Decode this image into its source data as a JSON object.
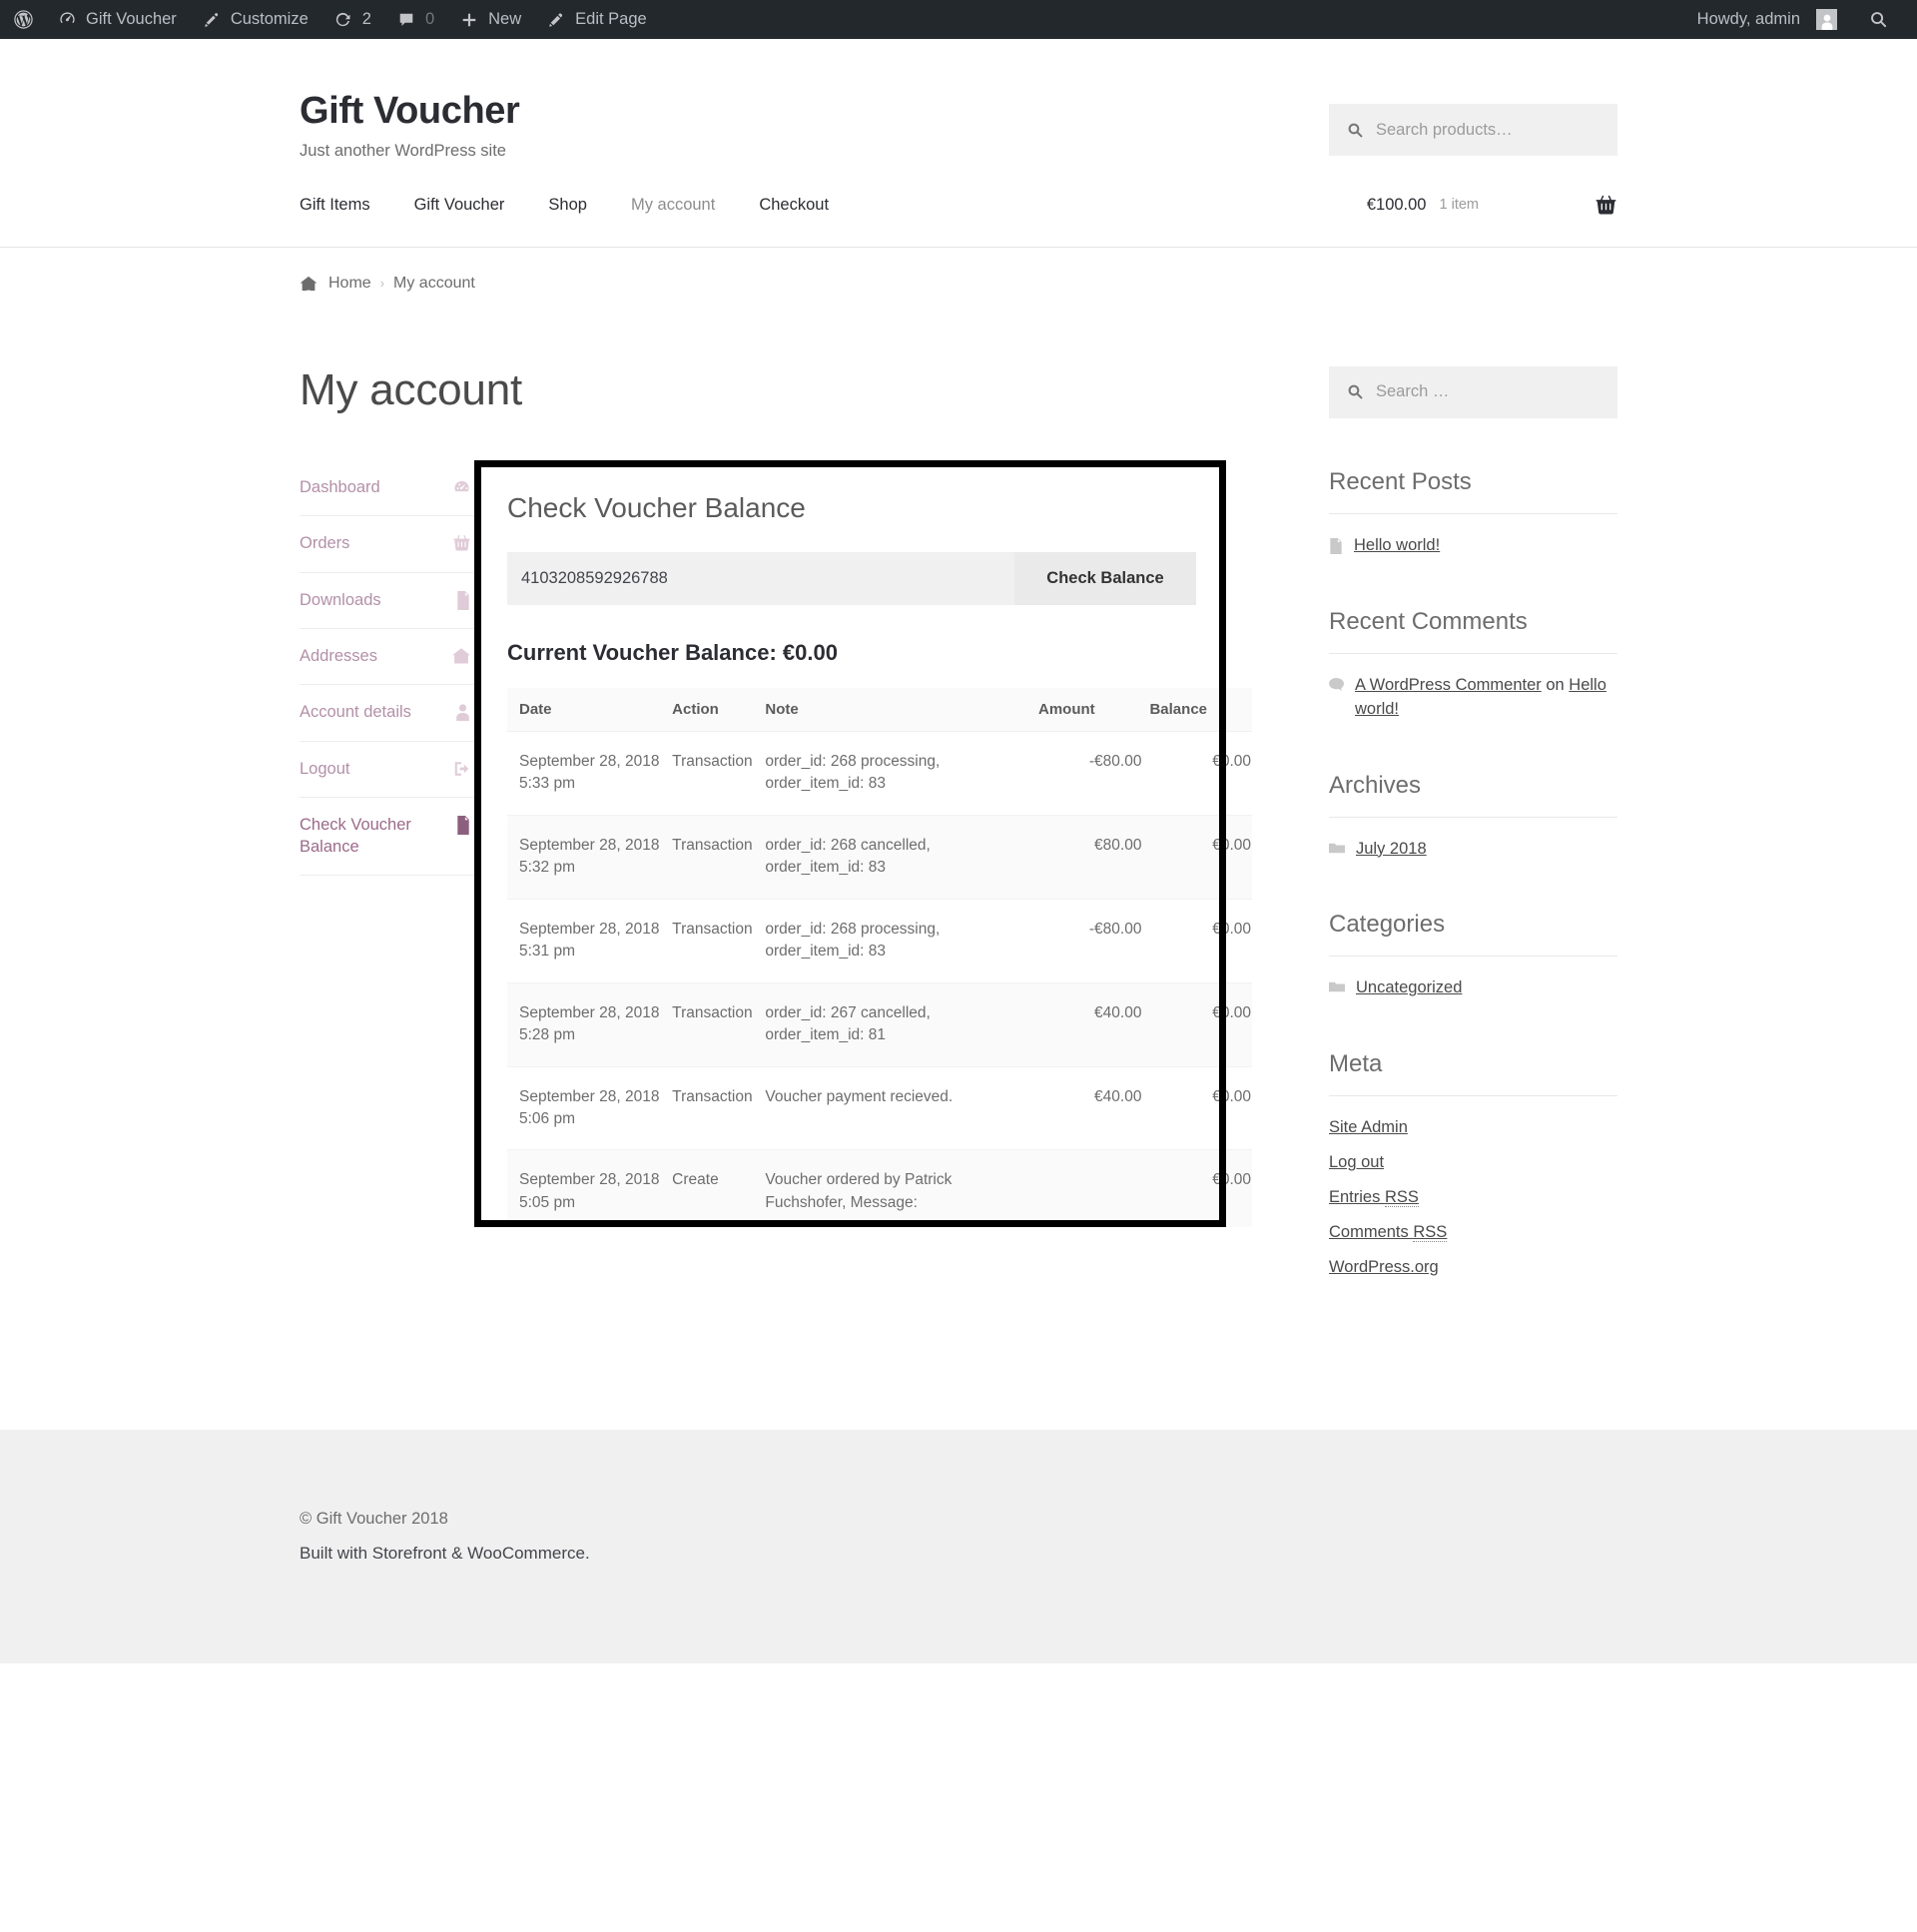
{
  "adminbar": {
    "wp_logo_name": "wordpress-logo-icon",
    "items": [
      {
        "icon": "dashboard-icon",
        "label": "Gift Voucher"
      },
      {
        "icon": "brush-icon",
        "label": "Customize"
      },
      {
        "icon": "revision-icon",
        "label": "2"
      },
      {
        "icon": "comment-bubble-icon",
        "label": "0"
      },
      {
        "icon": "plus-icon",
        "label": "New"
      },
      {
        "icon": "pencil-icon",
        "label": "Edit Page"
      }
    ],
    "howdy": "Howdy, admin",
    "search_icon": "search-icon"
  },
  "header": {
    "site_title": "Gift Voucher",
    "site_description": "Just another WordPress site",
    "product_search_placeholder": "Search products…",
    "nav": [
      {
        "label": "Gift Items",
        "active": false
      },
      {
        "label": "Gift Voucher",
        "active": false
      },
      {
        "label": "Shop",
        "active": false
      },
      {
        "label": "My account",
        "active": true
      },
      {
        "label": "Checkout",
        "active": false
      }
    ],
    "cart_amount": "€100.00",
    "cart_count": "1 item"
  },
  "breadcrumb": {
    "home": "Home",
    "separator": "›",
    "current": "My account"
  },
  "main": {
    "page_title": "My account",
    "account_nav": [
      {
        "label": "Dashboard",
        "icon": "dashboard-gauge-icon",
        "active": false
      },
      {
        "label": "Orders",
        "icon": "basket-icon",
        "active": false
      },
      {
        "label": "Downloads",
        "icon": "file-zip-icon",
        "active": false
      },
      {
        "label": "Addresses",
        "icon": "home-icon",
        "active": false
      },
      {
        "label": "Account details",
        "icon": "person-icon",
        "active": false
      },
      {
        "label": "Logout",
        "icon": "logout-arrow-icon",
        "active": false
      },
      {
        "label": "Check Voucher Balance",
        "icon": "document-icon",
        "active": true
      }
    ]
  },
  "voucher": {
    "panel_heading": "Check Voucher Balance",
    "code_value": "4103208592926788",
    "check_button": "Check Balance",
    "current_balance_label": "Current Voucher Balance: €0.00",
    "table": {
      "columns": [
        "Date",
        "Action",
        "Note",
        "Amount",
        "Balance"
      ],
      "rows": [
        {
          "date": "September 28, 2018 5:33 pm",
          "action": "Transaction",
          "note": "order_id: 268 processing, order_item_id: 83",
          "amount": "-€80.00",
          "amount_negative": true,
          "balance": "€0.00"
        },
        {
          "date": "September 28, 2018 5:32 pm",
          "action": "Transaction",
          "note": "order_id: 268 cancelled, order_item_id: 83",
          "amount": "€80.00",
          "amount_negative": false,
          "balance": "€0.00"
        },
        {
          "date": "September 28, 2018 5:31 pm",
          "action": "Transaction",
          "note": "order_id: 268 processing, order_item_id: 83",
          "amount": "-€80.00",
          "amount_negative": true,
          "balance": "€0.00"
        },
        {
          "date": "September 28, 2018 5:28 pm",
          "action": "Transaction",
          "note": "order_id: 267 cancelled, order_item_id: 81",
          "amount": "€40.00",
          "amount_negative": false,
          "balance": "€0.00"
        },
        {
          "date": "September 28, 2018 5:06 pm",
          "action": "Transaction",
          "note": "Voucher payment recieved.",
          "amount": "€40.00",
          "amount_negative": false,
          "balance": "€0.00"
        },
        {
          "date": "September 28, 2018 5:05 pm",
          "action": "Create",
          "note": "Voucher ordered by Patrick Fuchshofer, Message:",
          "amount": "",
          "amount_negative": false,
          "balance": "€0.00"
        }
      ]
    }
  },
  "sidebar": {
    "search_placeholder": "Search …",
    "recent_posts": {
      "title": "Recent Posts",
      "items": [
        {
          "label": "Hello world!",
          "icon": "post-icon"
        }
      ]
    },
    "recent_comments": {
      "title": "Recent Comments",
      "items": [
        {
          "icon": "comment-icon",
          "author": "A WordPress Commenter",
          "on": " on ",
          "post": "Hello world!"
        }
      ]
    },
    "archives": {
      "title": "Archives",
      "items": [
        {
          "label": "July 2018",
          "icon": "folder-icon"
        }
      ]
    },
    "categories": {
      "title": "Categories",
      "items": [
        {
          "label": "Uncategorized",
          "icon": "folder-icon"
        }
      ]
    },
    "meta": {
      "title": "Meta",
      "items": [
        {
          "label": "Site Admin"
        },
        {
          "label": "Log out"
        },
        {
          "label": "Entries RSS",
          "abbr": "RSS",
          "prefix": "Entries "
        },
        {
          "label": "Comments RSS",
          "abbr": "RSS",
          "prefix": "Comments "
        },
        {
          "label": "WordPress.org"
        }
      ]
    }
  },
  "footer": {
    "copyright": "© Gift Voucher 2018",
    "built_with": "Built with Storefront & WooCommerce."
  },
  "colors": {
    "adminbar_bg": "#23282d",
    "accent_pink": "#b390a8",
    "negative_red": "#e02b27",
    "frame_black": "#000000"
  }
}
